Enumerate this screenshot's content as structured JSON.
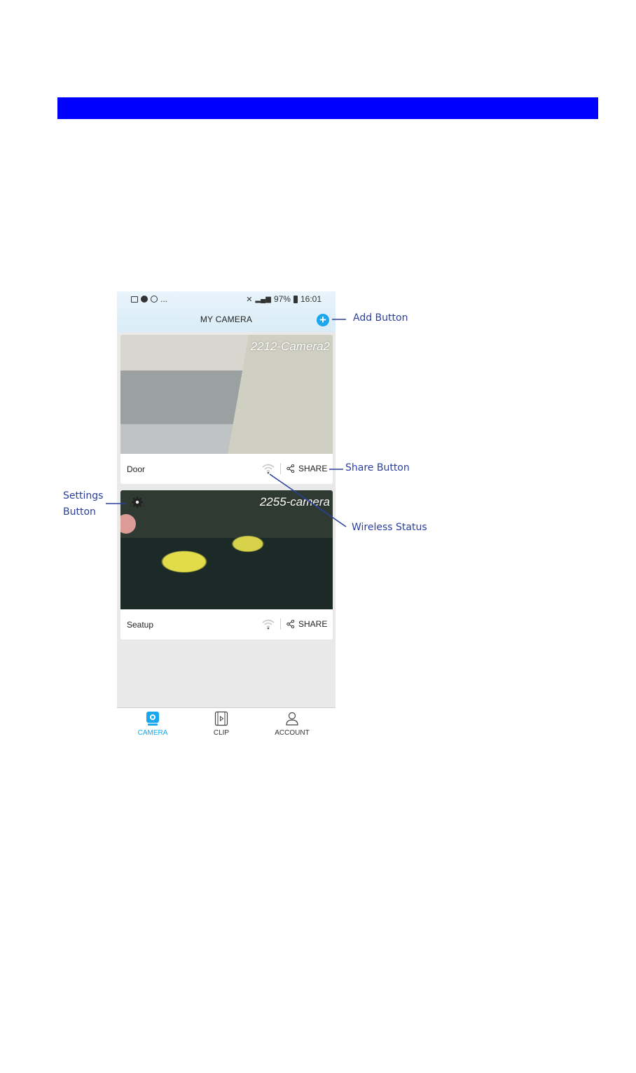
{
  "status_bar": {
    "battery": "97%",
    "time": "16:01",
    "dots": "..."
  },
  "header": {
    "title": "MY CAMERA"
  },
  "cameras": [
    {
      "feed_title": "2212-Camera2",
      "name": "Door",
      "share_label": "SHARE"
    },
    {
      "feed_title": "2255-camera",
      "name": "Seatup",
      "share_label": "SHARE"
    }
  ],
  "tabs": [
    {
      "label": "CAMERA"
    },
    {
      "label": "CLIP"
    },
    {
      "label": "ACCOUNT"
    }
  ],
  "annotations": {
    "add_button": "Add Button",
    "share_button": "Share Button",
    "settings_line1": "Settings",
    "settings_line2": "Button",
    "wireless_status": "Wireless Status"
  },
  "colors": {
    "accent": "#1aa7ee",
    "banner": "#0000ff",
    "annotation": "#2b3f9e"
  }
}
